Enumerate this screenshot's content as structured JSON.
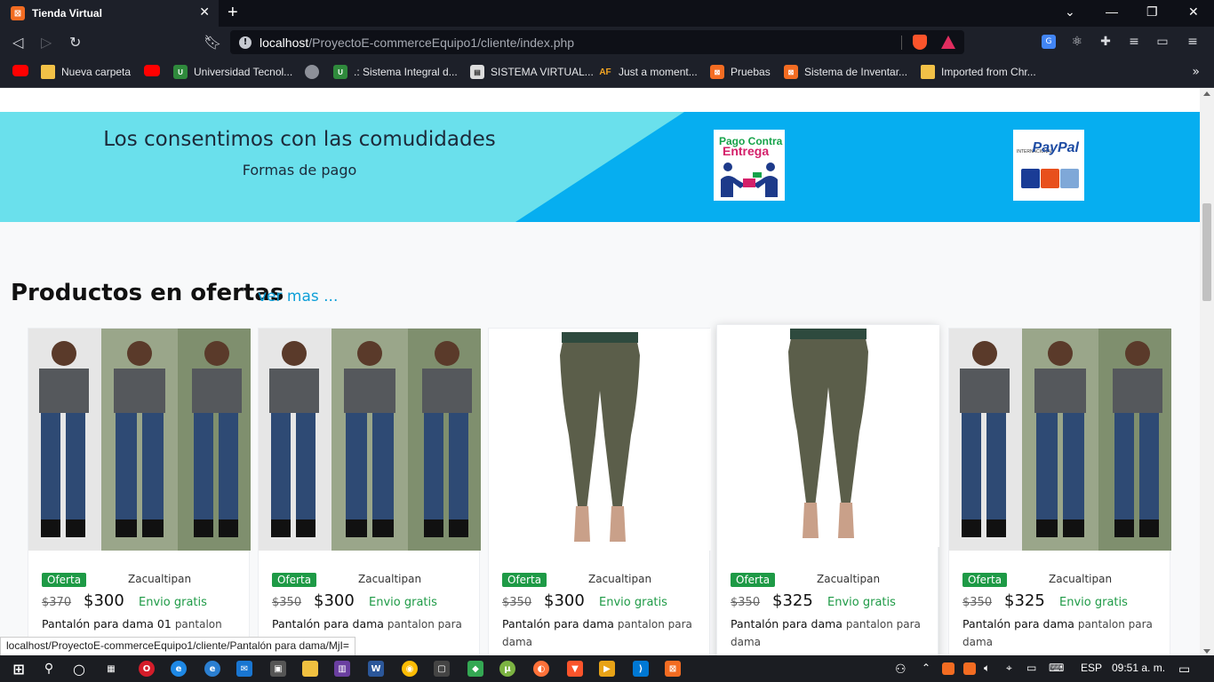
{
  "browser": {
    "tab_title": "Tienda Virtual",
    "url_host": "localhost",
    "url_path": "/ProyectoE-commerceEquipo1/cliente/index.php",
    "bookmarks": [
      {
        "label": "",
        "icon": "youtube-icon"
      },
      {
        "label": "Nueva carpeta",
        "icon": "folder-icon"
      },
      {
        "label": "",
        "icon": "youtube-icon"
      },
      {
        "label": "Universidad Tecnol...",
        "icon": "utt-icon"
      },
      {
        "label": "",
        "icon": "globe-icon"
      },
      {
        "label": ".: Sistema Integral d...",
        "icon": "utt-icon"
      },
      {
        "label": "SISTEMA VIRTUAL...",
        "icon": "sv-icon"
      },
      {
        "label": "Just a moment...",
        "icon": "af-icon"
      },
      {
        "label": "Pruebas",
        "icon": "xampp-icon"
      },
      {
        "label": "Sistema de Inventar...",
        "icon": "xampp-icon"
      },
      {
        "label": "Imported from Chr...",
        "icon": "folder-icon"
      }
    ]
  },
  "promo": {
    "title": "Los consentimos con las comudidades",
    "subtitle": "Formas de pago",
    "pce_line1": "Pago Contra",
    "pce_line2": "Entrega",
    "paypal_word": "PayPal",
    "paypal_small": "INTERNACIONAL"
  },
  "section": {
    "title": "Productos en ofertas",
    "see_more": "ver mas ..."
  },
  "products": [
    {
      "badge": "Oferta",
      "store": "Zacualtipan",
      "old_price": "$370",
      "price": "$300",
      "shipping": "Envio gratis",
      "name": "Pantalón para dama 01",
      "desc": "pantalon para",
      "image": "jeans-woman"
    },
    {
      "badge": "Oferta",
      "store": "Zacualtipan",
      "old_price": "$350",
      "price": "$300",
      "shipping": "Envio gratis",
      "name": "Pantalón para dama",
      "desc": "pantalon para",
      "image": "jeans-woman"
    },
    {
      "badge": "Oferta",
      "store": "Zacualtipan",
      "old_price": "$350",
      "price": "$300",
      "shipping": "Envio gratis",
      "name": "Pantalón para dama",
      "desc": "pantalon para dama",
      "image": "olive-pants"
    },
    {
      "badge": "Oferta",
      "store": "Zacualtipan",
      "old_price": "$350",
      "price": "$325",
      "shipping": "Envio gratis",
      "name": "Pantalón para dama",
      "desc": "pantalon para dama",
      "image": "olive-pants"
    },
    {
      "badge": "Oferta",
      "store": "Zacualtipan",
      "old_price": "$350",
      "price": "$325",
      "shipping": "Envio gratis",
      "name": "Pantalón para dama",
      "desc": "pantalon para dama",
      "image": "jeans-woman"
    }
  ],
  "status_bar_url": "localhost/ProyectoE-commerceEquipo1/cliente/Pantalón para dama/MjI=",
  "taskbar": {
    "language": "ESP",
    "time": "09:51 a. m."
  },
  "colors": {
    "promo_light": "#6ae0ec",
    "promo_dark": "#06aef0",
    "offer_badge": "#1e9a46",
    "link": "#0d9fd8"
  }
}
